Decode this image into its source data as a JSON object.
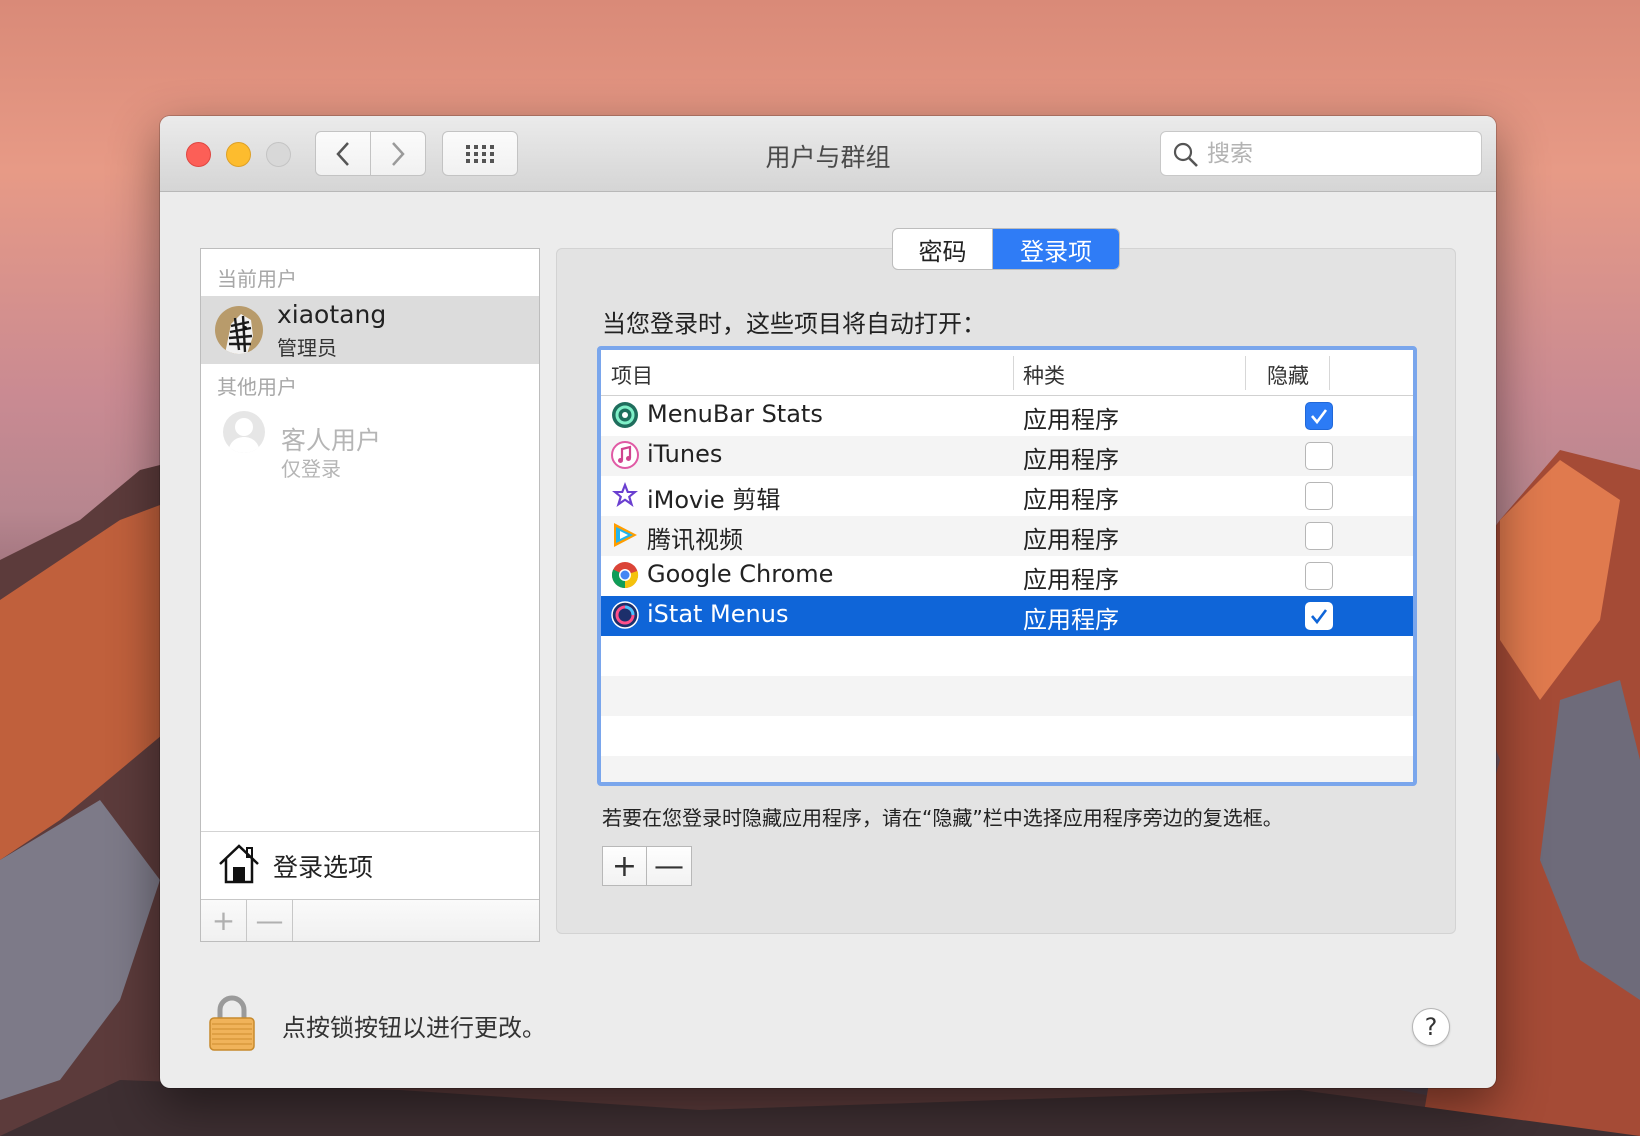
{
  "window": {
    "title": "用户与群组"
  },
  "search": {
    "placeholder": "搜索"
  },
  "sidebar": {
    "current_section": "当前用户",
    "current_user": {
      "name": "xiaotang",
      "role": "管理员"
    },
    "other_section": "其他用户",
    "guest": {
      "name": "客人用户",
      "role": "仅登录"
    },
    "login_options": "登录选项",
    "add_label": "+",
    "remove_label": "—"
  },
  "tabs": [
    {
      "label": "密码",
      "selected": false
    },
    {
      "label": "登录项",
      "selected": true
    }
  ],
  "main": {
    "heading": "当您登录时，这些项目将自动打开：",
    "columns": {
      "item": "项目",
      "kind": "种类",
      "hide": "隐藏"
    },
    "rows": [
      {
        "name": "MenuBar Stats",
        "kind": "应用程序",
        "hidden": true,
        "icon": "menubar-stats-icon"
      },
      {
        "name": "iTunes",
        "kind": "应用程序",
        "hidden": false,
        "icon": "itunes-icon"
      },
      {
        "name": "iMovie 剪辑",
        "kind": "应用程序",
        "hidden": false,
        "icon": "imovie-icon"
      },
      {
        "name": "腾讯视频",
        "kind": "应用程序",
        "hidden": false,
        "icon": "tencent-video-icon"
      },
      {
        "name": "Google Chrome",
        "kind": "应用程序",
        "hidden": false,
        "icon": "chrome-icon"
      },
      {
        "name": "iStat Menus",
        "kind": "应用程序",
        "hidden": true,
        "icon": "istat-menus-icon",
        "selected": true
      }
    ],
    "hint": "若要在您登录时隐藏应用程序，请在“隐藏”栏中选择应用程序旁边的复选框。",
    "add_label": "+",
    "remove_label": "—"
  },
  "footer": {
    "lock_text": "点按锁按钮以进行更改。",
    "help_label": "?"
  },
  "colors": {
    "selection": "#0f65d8",
    "accent": "#2f7cf6"
  }
}
